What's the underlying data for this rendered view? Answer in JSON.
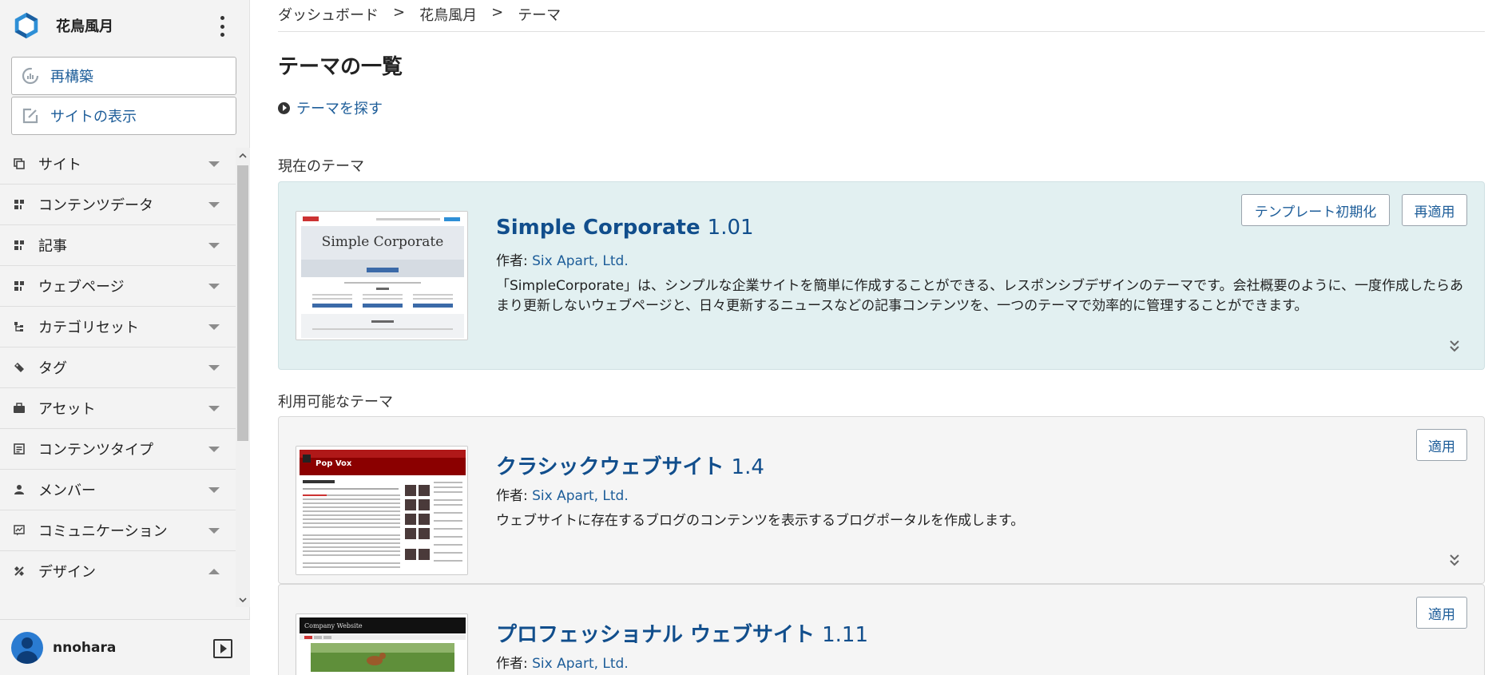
{
  "brand": {
    "name": "花鳥風月"
  },
  "sidebar": {
    "rebuild_label": "再構築",
    "view_site_label": "サイトの表示",
    "items": [
      {
        "label": "サイト",
        "icon": "site-icon"
      },
      {
        "label": "コンテンツデータ",
        "icon": "content-data-icon"
      },
      {
        "label": "記事",
        "icon": "entry-icon"
      },
      {
        "label": "ウェブページ",
        "icon": "webpage-icon"
      },
      {
        "label": "カテゴリセット",
        "icon": "category-set-icon"
      },
      {
        "label": "タグ",
        "icon": "tag-icon"
      },
      {
        "label": "アセット",
        "icon": "asset-icon"
      },
      {
        "label": "コンテンツタイプ",
        "icon": "content-type-icon"
      },
      {
        "label": "メンバー",
        "icon": "member-icon"
      },
      {
        "label": "コミュニケーション",
        "icon": "communication-icon"
      },
      {
        "label": "デザイン",
        "icon": "design-icon"
      }
    ]
  },
  "user": {
    "name": "nnohara"
  },
  "breadcrumb": {
    "item1": "ダッシュボード",
    "item2": "花鳥風月",
    "item3": "テーマ",
    "sep": ">"
  },
  "page": {
    "title": "テーマの一覧",
    "find_themes": "テーマを探す",
    "current_label": "現在のテーマ",
    "available_label": "利用可能なテーマ"
  },
  "themes": {
    "current": {
      "name": "Simple Corporate",
      "version": "1.01",
      "author_label": "作者:",
      "author": "Six Apart, Ltd.",
      "description": "「SimpleCorporate」は、シンプルな企業サイトを簡単に作成することができる、レスポンシブデザインのテーマです。会社概要のように、一度作成したらあまり更新しないウェブページと、日々更新するニュースなどの記事コンテンツを、一つのテーマで効率的に管理することができます。",
      "reset_label": "テンプレート初期化",
      "reapply_label": "再適用",
      "thumb_title": "Simple Corporate"
    },
    "classic": {
      "name": "クラシックウェブサイト",
      "version": "1.4",
      "author_label": "作者:",
      "author": "Six Apart, Ltd.",
      "description": "ウェブサイトに存在するブログのコンテンツを表示するブログポータルを作成します。",
      "apply_label": "適用",
      "thumb_title": "Pop Vox"
    },
    "professional": {
      "name": "プロフェッショナル ウェブサイト",
      "version": "1.11",
      "author_label": "作者:",
      "author": "Six Apart, Ltd.",
      "apply_label": "適用",
      "thumb_title": "Company Website"
    }
  },
  "colors": {
    "link": "#1d5d99",
    "title": "#114e8c",
    "current_bg": "#e2f0f1"
  }
}
